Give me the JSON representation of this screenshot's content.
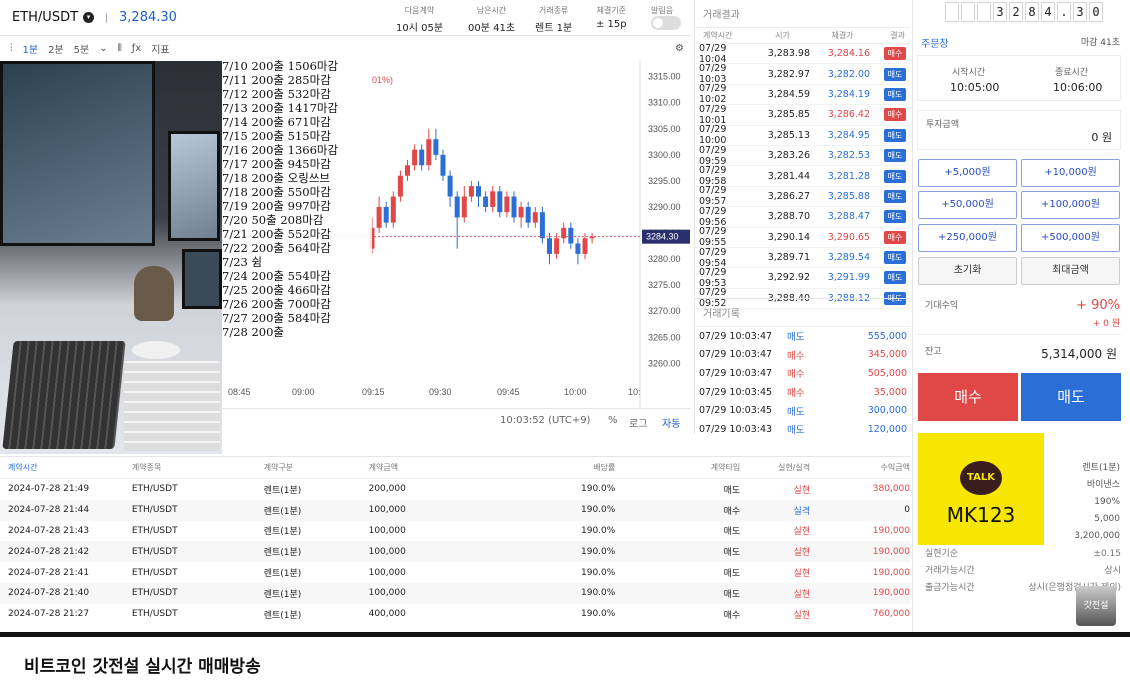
{
  "header": {
    "symbol": "ETH/USDT",
    "price": "3,284.30",
    "stats": [
      {
        "label": "다음계약",
        "value": "10시 05분"
      },
      {
        "label": "남은시간",
        "value": "00분 41초"
      },
      {
        "label": "거래종류",
        "value": "렌트 1분"
      },
      {
        "label": "체결기준",
        "value": "± 15p"
      },
      {
        "label": "알림음",
        "value": ""
      }
    ]
  },
  "toolbar": {
    "intervals": [
      "1분",
      "2분",
      "5분"
    ],
    "indicator": "지표"
  },
  "chart_data": {
    "type": "candlestick",
    "current_price_label": "3284.30",
    "yticks": [
      3315,
      3310,
      3305,
      3300,
      3295,
      3290,
      3285,
      3280,
      3275,
      3270,
      3265,
      3260
    ],
    "yticks_labels": [
      "3315.00",
      "3310.00",
      "3305.00",
      "3300.00",
      "3295.00",
      "3290.00",
      "3285.00",
      "3280.00",
      "3275.00",
      "3270.00",
      "3265.00",
      "3260.00"
    ],
    "xticks": [
      "08:45",
      "09:00",
      "09:15",
      "09:30",
      "09:45",
      "10:00",
      "10:"
    ],
    "ylim": [
      3257,
      3318
    ],
    "partial_legend": "01%)",
    "candles": [
      {
        "o": 3282,
        "c": 3286,
        "h": 3288,
        "l": 3281
      },
      {
        "o": 3286,
        "c": 3290,
        "h": 3292,
        "l": 3285
      },
      {
        "o": 3290,
        "c": 3287,
        "h": 3291,
        "l": 3286
      },
      {
        "o": 3287,
        "c": 3292,
        "h": 3293,
        "l": 3286
      },
      {
        "o": 3292,
        "c": 3296,
        "h": 3297,
        "l": 3291
      },
      {
        "o": 3296,
        "c": 3298,
        "h": 3299,
        "l": 3295
      },
      {
        "o": 3298,
        "c": 3301,
        "h": 3302,
        "l": 3297
      },
      {
        "o": 3301,
        "c": 3298,
        "h": 3302,
        "l": 3297
      },
      {
        "o": 3298,
        "c": 3303,
        "h": 3305,
        "l": 3297
      },
      {
        "o": 3303,
        "c": 3300,
        "h": 3305,
        "l": 3299
      },
      {
        "o": 3300,
        "c": 3296,
        "h": 3301,
        "l": 3295
      },
      {
        "o": 3296,
        "c": 3292,
        "h": 3297,
        "l": 3290
      },
      {
        "o": 3292,
        "c": 3288,
        "h": 3293,
        "l": 3282
      },
      {
        "o": 3288,
        "c": 3292,
        "h": 3294,
        "l": 3287
      },
      {
        "o": 3292,
        "c": 3294,
        "h": 3295,
        "l": 3291
      },
      {
        "o": 3294,
        "c": 3292,
        "h": 3295,
        "l": 3290
      },
      {
        "o": 3292,
        "c": 3290,
        "h": 3293,
        "l": 3289
      },
      {
        "o": 3290,
        "c": 3293,
        "h": 3294,
        "l": 3289
      },
      {
        "o": 3293,
        "c": 3289,
        "h": 3294,
        "l": 3288
      },
      {
        "o": 3289,
        "c": 3292,
        "h": 3293,
        "l": 3288
      },
      {
        "o": 3292,
        "c": 3288,
        "h": 3293,
        "l": 3287
      },
      {
        "o": 3288,
        "c": 3290,
        "h": 3291,
        "l": 3286
      },
      {
        "o": 3290,
        "c": 3287,
        "h": 3291,
        "l": 3286
      },
      {
        "o": 3287,
        "c": 3289,
        "h": 3290,
        "l": 3286
      },
      {
        "o": 3289,
        "c": 3284,
        "h": 3290,
        "l": 3283
      },
      {
        "o": 3284,
        "c": 3281,
        "h": 3285,
        "l": 3279
      },
      {
        "o": 3281,
        "c": 3284,
        "h": 3285,
        "l": 3280
      },
      {
        "o": 3284,
        "c": 3286,
        "h": 3287,
        "l": 3283
      },
      {
        "o": 3286,
        "c": 3283,
        "h": 3287,
        "l": 3282
      },
      {
        "o": 3283,
        "c": 3281,
        "h": 3284,
        "l": 3279
      },
      {
        "o": 3281,
        "c": 3284,
        "h": 3285,
        "l": 3280
      },
      {
        "o": 3284,
        "c": 3284.3,
        "h": 3285,
        "l": 3283
      }
    ]
  },
  "chart_footer": {
    "time": "10:03:52 (UTC+9)",
    "percent": "%",
    "log": "로그",
    "auto": "자동"
  },
  "notes": [
    "7/10 200출 1506마감",
    "7/11 200출 285마감",
    "7/12 200출 532마감",
    "7/13 200출 1417마감",
    "7/14 200출 671마감",
    "7/15 200출 515마감",
    "7/16 200출 1366마감",
    "7/17 200출 945마감",
    "7/18 200출 오링쓰브",
    "7/18 200출 550마감",
    "7/19 200출 997마감",
    "7/20 50출  208마감",
    "7/21 200출 552마감",
    "7/22 200출 564마감",
    "7/23 쉼",
    "7/24 200출 554마감",
    "7/25 200출 466마감",
    "7/26 200출 700마감",
    "7/27 200출 584마감",
    "7/28 200출"
  ],
  "trade_results": {
    "title": "거래결과",
    "columns": [
      "계약시간",
      "시가",
      "체결가",
      "결과"
    ],
    "rows": [
      {
        "time": "07/29 10:04",
        "open": "3,283.98",
        "close": "3,284.16",
        "result": "매수",
        "type": "buy"
      },
      {
        "time": "07/29 10:03",
        "open": "3,282.97",
        "close": "3,282.00",
        "result": "매도",
        "type": "sell"
      },
      {
        "time": "07/29 10:02",
        "open": "3,284.59",
        "close": "3,284.19",
        "result": "매도",
        "type": "sell"
      },
      {
        "time": "07/29 10:01",
        "open": "3,285.85",
        "close": "3,286.42",
        "result": "매수",
        "type": "buy"
      },
      {
        "time": "07/29 10:00",
        "open": "3,285.13",
        "close": "3,284.95",
        "result": "매도",
        "type": "sell"
      },
      {
        "time": "07/29 09:59",
        "open": "3,283.26",
        "close": "3,282.53",
        "result": "매도",
        "type": "sell"
      },
      {
        "time": "07/29 09:58",
        "open": "3,281.44",
        "close": "3,281.28",
        "result": "매도",
        "type": "sell"
      },
      {
        "time": "07/29 09:57",
        "open": "3,286.27",
        "close": "3,285.88",
        "result": "매도",
        "type": "sell"
      },
      {
        "time": "07/29 09:56",
        "open": "3,288.70",
        "close": "3,288.47",
        "result": "매도",
        "type": "sell"
      },
      {
        "time": "07/29 09:55",
        "open": "3,290.14",
        "close": "3,290.65",
        "result": "매수",
        "type": "buy"
      },
      {
        "time": "07/29 09:54",
        "open": "3,289.71",
        "close": "3,289.54",
        "result": "매도",
        "type": "sell"
      },
      {
        "time": "07/29 09:53",
        "open": "3,292.92",
        "close": "3,291.99",
        "result": "매도",
        "type": "sell"
      },
      {
        "time": "07/29 09:52",
        "open": "3,288.40",
        "close": "3,288.12",
        "result": "매도",
        "type": "sell"
      }
    ]
  },
  "trade_record": {
    "title": "거래기록",
    "rows": [
      {
        "time": "07/29 10:03:47",
        "side": "매도",
        "amount": "555,000",
        "type": "sell"
      },
      {
        "time": "07/29 10:03:47",
        "side": "매수",
        "amount": "345,000",
        "type": "buy"
      },
      {
        "time": "07/29 10:03:47",
        "side": "매수",
        "amount": "505,000",
        "type": "buy"
      },
      {
        "time": "07/29 10:03:45",
        "side": "매수",
        "amount": "35,000",
        "type": "buy"
      },
      {
        "time": "07/29 10:03:45",
        "side": "매도",
        "amount": "300,000",
        "type": "sell"
      },
      {
        "time": "07/29 10:03:43",
        "side": "매도",
        "amount": "120,000",
        "type": "sell"
      }
    ]
  },
  "order": {
    "ticker_digits": [
      "",
      "",
      "",
      "3",
      "2",
      "8",
      "4",
      ".",
      "3",
      "0"
    ],
    "title": "주문창",
    "deadline": "마감 41초",
    "start_label": "시작시간",
    "start_value": "10:05:00",
    "end_label": "종료시간",
    "end_value": "10:06:00",
    "invest_label": "투자금액",
    "invest_value": "0 원",
    "amount_buttons": [
      "+5,000원",
      "+10,000원",
      "+50,000원",
      "+100,000원",
      "+250,000원",
      "+500,000원"
    ],
    "reset": "초기화",
    "max": "최대금액",
    "expected_label": "기대수익",
    "expected_pct": "+ 90%",
    "expected_amt": "+ 0 원",
    "balance_label": "잔고",
    "balance_value": "5,314,000 원",
    "buy": "매수",
    "sell": "매도",
    "info_values": [
      "렌트(1분)",
      "바이낸스",
      "190%",
      "5,000",
      "3,200,000"
    ],
    "info_rows": [
      {
        "label": "실현기순",
        "value": "±0.15"
      },
      {
        "label": "거래가능시간",
        "value": "상시"
      },
      {
        "label": "출금가능시간",
        "value": "상시(은행점검시간 제외)"
      }
    ],
    "kakao_badge": "TALK",
    "kakao_id": "MK123",
    "watermark": "갓전설"
  },
  "history": {
    "columns": [
      "계약시간",
      "계약종목",
      "계약구분",
      "계약금액",
      "배당률",
      "계약타입",
      "실현/실격",
      "수익금액"
    ],
    "rows": [
      [
        "2024-07-28 21:49",
        "ETH/USDT",
        "렌트(1분)",
        "200,000",
        "190.0%",
        "매도",
        "실현",
        "380,000"
      ],
      [
        "2024-07-28 21:44",
        "ETH/USDT",
        "렌트(1분)",
        "100,000",
        "190.0%",
        "매수",
        "실격",
        "0"
      ],
      [
        "2024-07-28 21:43",
        "ETH/USDT",
        "렌트(1분)",
        "100,000",
        "190.0%",
        "매도",
        "실현",
        "190,000"
      ],
      [
        "2024-07-28 21:42",
        "ETH/USDT",
        "렌트(1분)",
        "100,000",
        "190.0%",
        "매도",
        "실현",
        "190,000"
      ],
      [
        "2024-07-28 21:41",
        "ETH/USDT",
        "렌트(1분)",
        "100,000",
        "190.0%",
        "매도",
        "실현",
        "190,000"
      ],
      [
        "2024-07-28 21:40",
        "ETH/USDT",
        "렌트(1분)",
        "100,000",
        "190.0%",
        "매도",
        "실현",
        "190,000"
      ],
      [
        "2024-07-28 21:27",
        "ETH/USDT",
        "렌트(1분)",
        "400,000",
        "190.0%",
        "매수",
        "실현",
        "760,000"
      ]
    ]
  },
  "caption": "비트코인 갓전설 실시간 매매방송",
  "colors": {
    "up": "#e04848",
    "down": "#2a6ed6",
    "accent": "#1c5fd0",
    "kakao": "#f7e600"
  }
}
